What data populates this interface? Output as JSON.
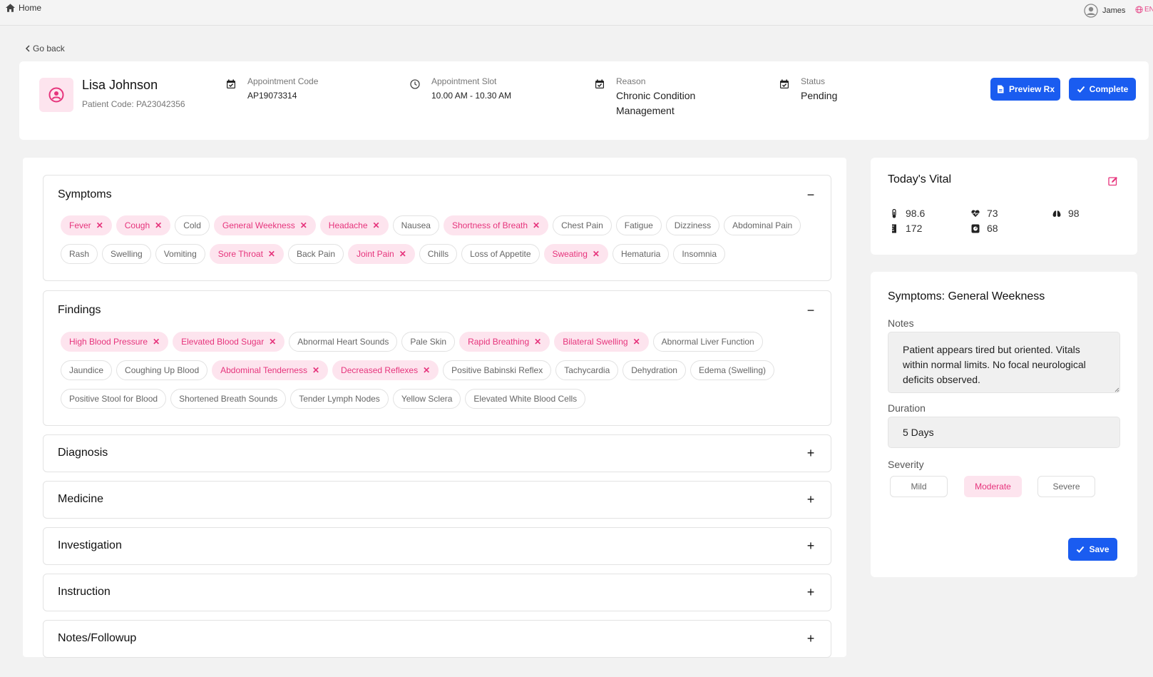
{
  "topbar": {
    "home_label": "Home",
    "user_name": "James",
    "lang": "EN"
  },
  "goback_label": "Go back",
  "patient": {
    "name": "Lisa Johnson",
    "code": "Patient Code: PA23042356",
    "appointment_code_label": "Appointment Code",
    "appointment_code": "AP19073314",
    "slot_label": "Appointment Slot",
    "slot": "10.00 AM - 10.30 AM",
    "reason_label": "Reason",
    "reason": "Chronic Condition Management",
    "status_label": "Status",
    "status": "Pending"
  },
  "actions": {
    "preview_label": "Preview Rx",
    "complete_label": "Complete"
  },
  "sections": {
    "symptoms": {
      "title": "Symptoms",
      "toggle": "−",
      "row1": [
        {
          "label": "Fever",
          "selected": true
        },
        {
          "label": "Cough",
          "selected": true
        },
        {
          "label": "Cold",
          "selected": false
        },
        {
          "label": "General Weekness",
          "selected": true
        },
        {
          "label": "Headache",
          "selected": true
        },
        {
          "label": "Nausea",
          "selected": false
        },
        {
          "label": "Shortness of Breath",
          "selected": true
        },
        {
          "label": "Chest Pain",
          "selected": false
        },
        {
          "label": "Fatigue",
          "selected": false
        },
        {
          "label": "Dizziness",
          "selected": false
        },
        {
          "label": "Abdominal Pain",
          "selected": false
        }
      ],
      "row2": [
        {
          "label": "Rash",
          "selected": false
        },
        {
          "label": "Swelling",
          "selected": false
        },
        {
          "label": "Vomiting",
          "selected": false
        },
        {
          "label": "Sore Throat",
          "selected": true
        },
        {
          "label": "Back Pain",
          "selected": false
        },
        {
          "label": "Joint Pain",
          "selected": true
        },
        {
          "label": "Chills",
          "selected": false
        },
        {
          "label": "Loss of Appetite",
          "selected": false
        },
        {
          "label": "Sweating",
          "selected": true
        },
        {
          "label": "Hematuria",
          "selected": false
        },
        {
          "label": "Insomnia",
          "selected": false
        }
      ]
    },
    "findings": {
      "title": "Findings",
      "toggle": "−",
      "row1": [
        {
          "label": "High Blood Pressure",
          "selected": true
        },
        {
          "label": "Elevated Blood Sugar",
          "selected": true
        },
        {
          "label": "Abnormal Heart Sounds",
          "selected": false
        },
        {
          "label": "Pale Skin",
          "selected": false
        },
        {
          "label": "Rapid Breathing",
          "selected": true
        },
        {
          "label": "Bilateral Swelling",
          "selected": true
        },
        {
          "label": "Abnormal Liver Function",
          "selected": false
        }
      ],
      "row2": [
        {
          "label": "Jaundice",
          "selected": false
        },
        {
          "label": "Coughing Up Blood",
          "selected": false
        },
        {
          "label": "Abdominal Tenderness",
          "selected": true
        },
        {
          "label": "Decreased Reflexes",
          "selected": true
        },
        {
          "label": "Positive Babinski Reflex",
          "selected": false
        },
        {
          "label": "Tachycardia",
          "selected": false
        },
        {
          "label": "Dehydration",
          "selected": false
        },
        {
          "label": "Edema (Swelling)",
          "selected": false
        }
      ],
      "row3": [
        {
          "label": "Positive Stool for Blood",
          "selected": false
        },
        {
          "label": "Shortened Breath Sounds",
          "selected": false
        },
        {
          "label": "Tender Lymph Nodes",
          "selected": false
        },
        {
          "label": "Yellow Sclera",
          "selected": false
        },
        {
          "label": "Elevated White Blood Cells",
          "selected": false
        }
      ]
    },
    "diagnosis": {
      "title": "Diagnosis",
      "toggle": "+"
    },
    "medicine": {
      "title": "Medicine",
      "toggle": "+"
    },
    "investigation": {
      "title": "Investigation",
      "toggle": "+"
    },
    "instruction": {
      "title": "Instruction",
      "toggle": "+"
    },
    "notes_followup": {
      "title": "Notes/Followup",
      "toggle": "+"
    }
  },
  "vitals": {
    "title": "Today's Vital",
    "temperature": "98.6",
    "heart_rate": "73",
    "spo2": "98",
    "height": "172",
    "weight": "68"
  },
  "symptom_detail": {
    "title": "Symptoms: General Weekness",
    "notes_label": "Notes",
    "notes": "Patient appears tired but oriented. Vitals within normal limits. No focal neurological deficits observed.",
    "duration_label": "Duration",
    "duration": "5 Days",
    "severity_label": "Severity",
    "severity_options": [
      "Mild",
      "Moderate",
      "Severe"
    ],
    "severity_selected": "Moderate",
    "save_label": "Save"
  },
  "colors": {
    "accent_pink": "#e6347c",
    "pink_bg": "#fde4ee",
    "primary_blue": "#1a5cf0"
  }
}
